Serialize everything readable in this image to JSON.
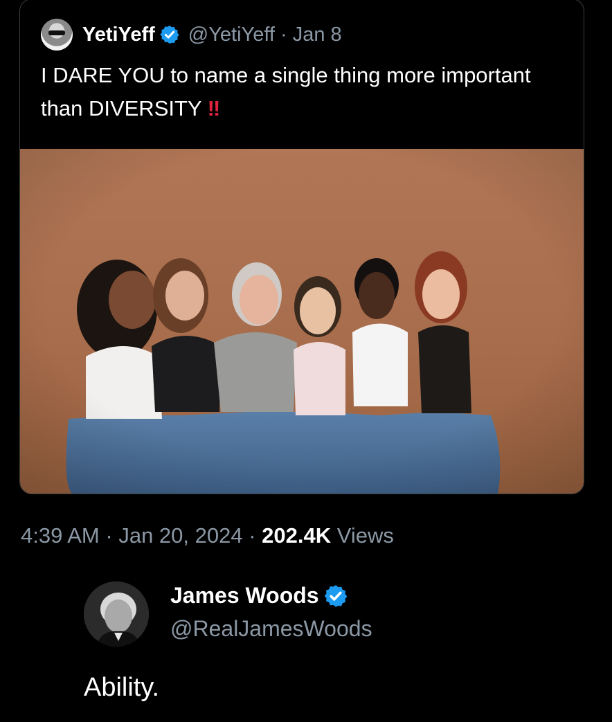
{
  "quoted_tweet": {
    "display_name": "YetiYeff",
    "handle": "@YetiYeff",
    "separator": "·",
    "date": "Jan 8",
    "text_main": "I DARE YOU to name a single thing more important than DIVERSITY ",
    "text_emoji": "!!",
    "avatar_icon": "profile-avatar-icon",
    "verified_icon": "verified-badge-icon",
    "media": {
      "icon": "photo-six-women-icon"
    }
  },
  "tweet_meta": {
    "time": "4:39 AM",
    "date": "Jan 20, 2024",
    "views_count": "202.4K",
    "views_label": "Views",
    "separator": "·"
  },
  "reply": {
    "display_name": "James Woods",
    "handle": "@RealJamesWoods",
    "text": "Ability.",
    "avatar_icon": "profile-avatar-icon",
    "verified_icon": "verified-badge-icon"
  },
  "colors": {
    "background": "#000000",
    "text_primary": "#ffffff",
    "text_secondary": "#8b98a5",
    "verified_blue": "#1d9bf0",
    "emoji_red": "#e0243f",
    "photo_backdrop": "#a86d4c"
  }
}
